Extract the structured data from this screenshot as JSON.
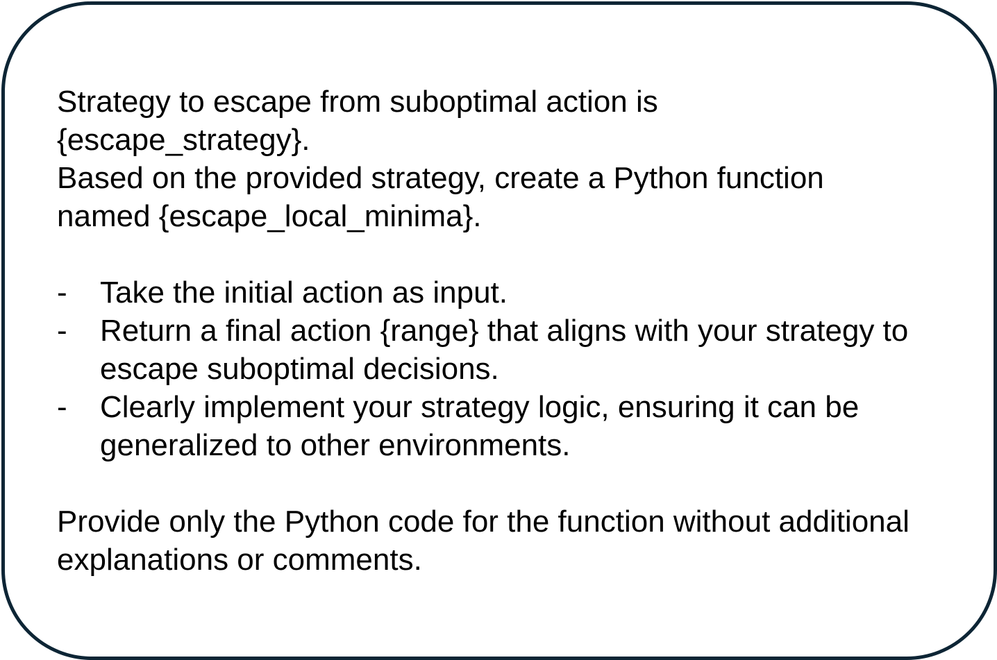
{
  "intro": {
    "line1": "Strategy to escape from suboptimal action is",
    "line2": "{escape_strategy}.",
    "line3": "Based on the provided strategy, create a Python function",
    "line4": "named {escape_local_minima}."
  },
  "bullets": [
    {
      "marker": "-",
      "lines": [
        "Take the initial action as input."
      ]
    },
    {
      "marker": "-",
      "lines": [
        "Return a final action {range} that aligns with your strategy to",
        "escape suboptimal decisions."
      ]
    },
    {
      "marker": "-",
      "lines": [
        "Clearly implement your strategy logic, ensuring it can be",
        "generalized to other environments."
      ]
    }
  ],
  "closing": {
    "line1": "Provide only the Python code for the function without additional",
    "line2": "explanations or comments."
  },
  "colors": {
    "border": "#0d2535",
    "text": "#000000",
    "background": "#ffffff"
  }
}
